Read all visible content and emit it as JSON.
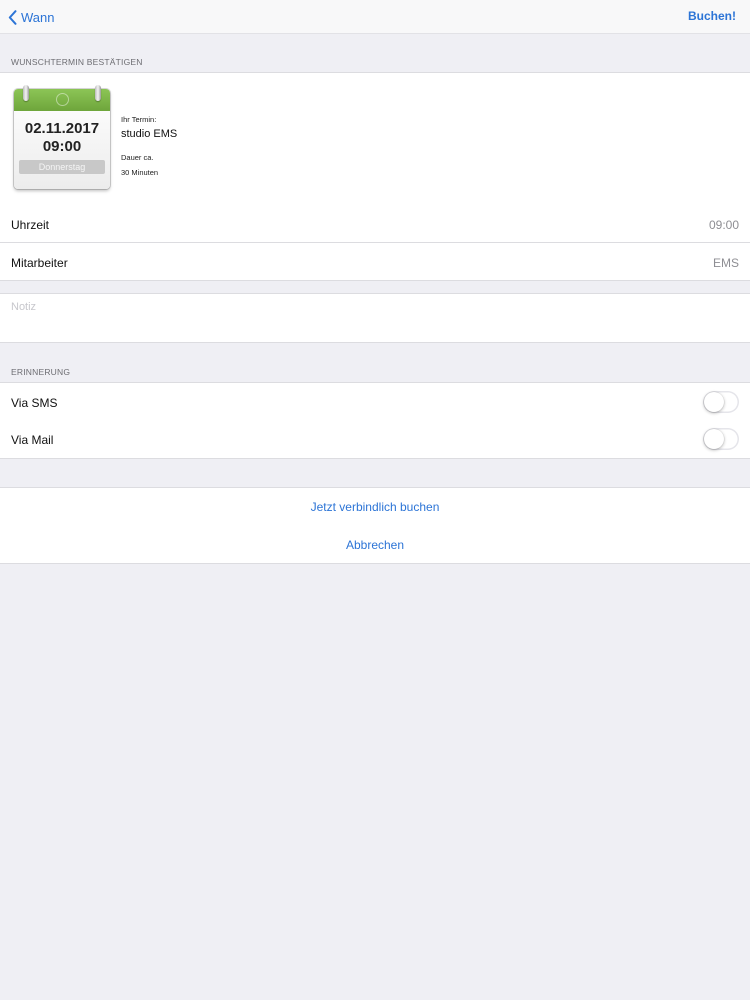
{
  "navbar": {
    "back_label": "Wann",
    "right_label": "Buchen!"
  },
  "booking": {
    "section_header": "WUNSCHTERMIN BESTÄTIGEN",
    "calendar": {
      "date": "02.11.2017",
      "time": "09:00",
      "weekday": "Donnerstag"
    },
    "appointment_label": "Ihr Termin:",
    "appointment_name": "studio EMS",
    "duration_label": "Dauer ca.",
    "duration_value": "30 Minuten",
    "rows": [
      {
        "label": "Uhrzeit",
        "value": "09:00"
      },
      {
        "label": "Mitarbeiter",
        "value": "EMS"
      }
    ]
  },
  "note": {
    "placeholder": "Notiz"
  },
  "reminder": {
    "section_header": "ERINNERUNG",
    "items": [
      {
        "label": "Via SMS",
        "enabled": false
      },
      {
        "label": "Via Mail",
        "enabled": false
      }
    ]
  },
  "actions": {
    "confirm": "Jetzt verbindlich buchen",
    "cancel": "Abbrechen"
  },
  "colors": {
    "accent": "#2c74d6",
    "background": "#efeff4",
    "calendar_green": "#7ab547"
  },
  "icons": {
    "back": "chevron-left-icon",
    "calendar": "calendar-icon"
  }
}
